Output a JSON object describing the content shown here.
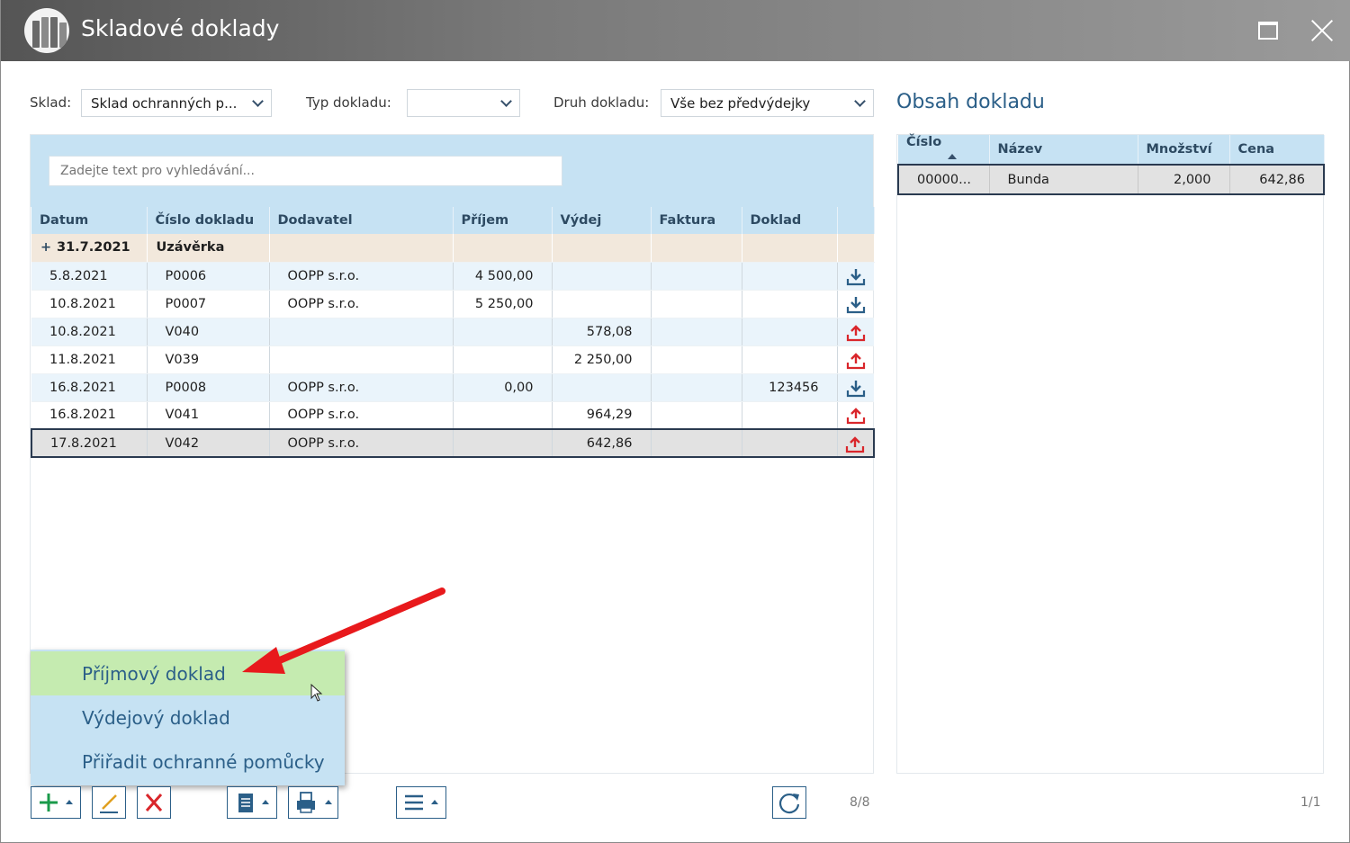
{
  "window": {
    "title": "Skladové doklady",
    "logo_icon": "books-icon",
    "maximize_icon": "maximize-icon",
    "close_icon": "close-icon"
  },
  "filters": {
    "sklad_label": "Sklad:",
    "sklad_value": "Sklad ochranných p...",
    "typ_label": "Typ dokladu:",
    "typ_value": "",
    "druh_label": "Druh dokladu:",
    "druh_value": "Vše bez předvýdejky"
  },
  "search": {
    "placeholder": "Zadejte text pro vyhledávání..."
  },
  "doc_table": {
    "columns": [
      "Datum",
      "Číslo dokladu",
      "Dodavatel",
      "Příjem",
      "Výdej",
      "Faktura",
      "Doklad",
      ""
    ],
    "group": {
      "expand": "+",
      "date": "31.7.2021",
      "label": "Uzávěrka"
    },
    "rows": [
      {
        "datum": "5.8.2021",
        "cislo": "P0006",
        "dodavatel": "OOPP s.r.o.",
        "prijem": "4 500,00",
        "vydej": "",
        "faktura": "",
        "doklad": "",
        "direction": "in"
      },
      {
        "datum": "10.8.2021",
        "cislo": "P0007",
        "dodavatel": "OOPP s.r.o.",
        "prijem": "5 250,00",
        "vydej": "",
        "faktura": "",
        "doklad": "",
        "direction": "in"
      },
      {
        "datum": "10.8.2021",
        "cislo": "V040",
        "dodavatel": "",
        "prijem": "",
        "vydej": "578,08",
        "faktura": "",
        "doklad": "",
        "direction": "out"
      },
      {
        "datum": "11.8.2021",
        "cislo": "V039",
        "dodavatel": "",
        "prijem": "",
        "vydej": "2 250,00",
        "faktura": "",
        "doklad": "",
        "direction": "out"
      },
      {
        "datum": "16.8.2021",
        "cislo": "P0008",
        "dodavatel": "OOPP s.r.o.",
        "prijem": "0,00",
        "vydej": "",
        "faktura": "",
        "doklad": "123456",
        "direction": "in"
      },
      {
        "datum": "16.8.2021",
        "cislo": "V041",
        "dodavatel": "OOPP s.r.o.",
        "prijem": "",
        "vydej": "964,29",
        "faktura": "",
        "doklad": "",
        "direction": "out"
      },
      {
        "datum": "17.8.2021",
        "cislo": "V042",
        "dodavatel": "OOPP s.r.o.",
        "prijem": "",
        "vydej": "642,86",
        "faktura": "",
        "doklad": "",
        "direction": "out"
      }
    ],
    "selected_row": 6
  },
  "content": {
    "title": "Obsah dokladu",
    "columns": [
      "Číslo",
      "Název",
      "Množství",
      "Cena"
    ],
    "rows": [
      {
        "cislo": "00000...",
        "nazev": "Bunda",
        "mnozstvi": "2,000",
        "cena": "642,86"
      }
    ],
    "counter": "1/1"
  },
  "popup_menu": {
    "items": [
      {
        "label": "Příjmový doklad",
        "highlighted": true
      },
      {
        "label": "Výdejový doklad",
        "highlighted": false
      },
      {
        "label": "Přiřadit ochranné pomůcky",
        "highlighted": false
      }
    ]
  },
  "toolbar": {
    "add_icon": "plus-icon",
    "edit_icon": "pencil-icon",
    "delete_icon": "delete-x-icon",
    "document_icon": "document-icon",
    "print_icon": "printer-icon",
    "menu_icon": "hamburger-menu-icon",
    "refresh_icon": "refresh-icon",
    "counter": "8/8"
  },
  "colors": {
    "accent_blue": "#2b5f88",
    "header_blue": "#c6e2f3",
    "highlight_green": "#c5ebb0",
    "group_row": "#f2e8dc",
    "in_icon": "#2b5f88",
    "out_icon": "#d9262b",
    "annotation_arrow": "#e8191c"
  }
}
